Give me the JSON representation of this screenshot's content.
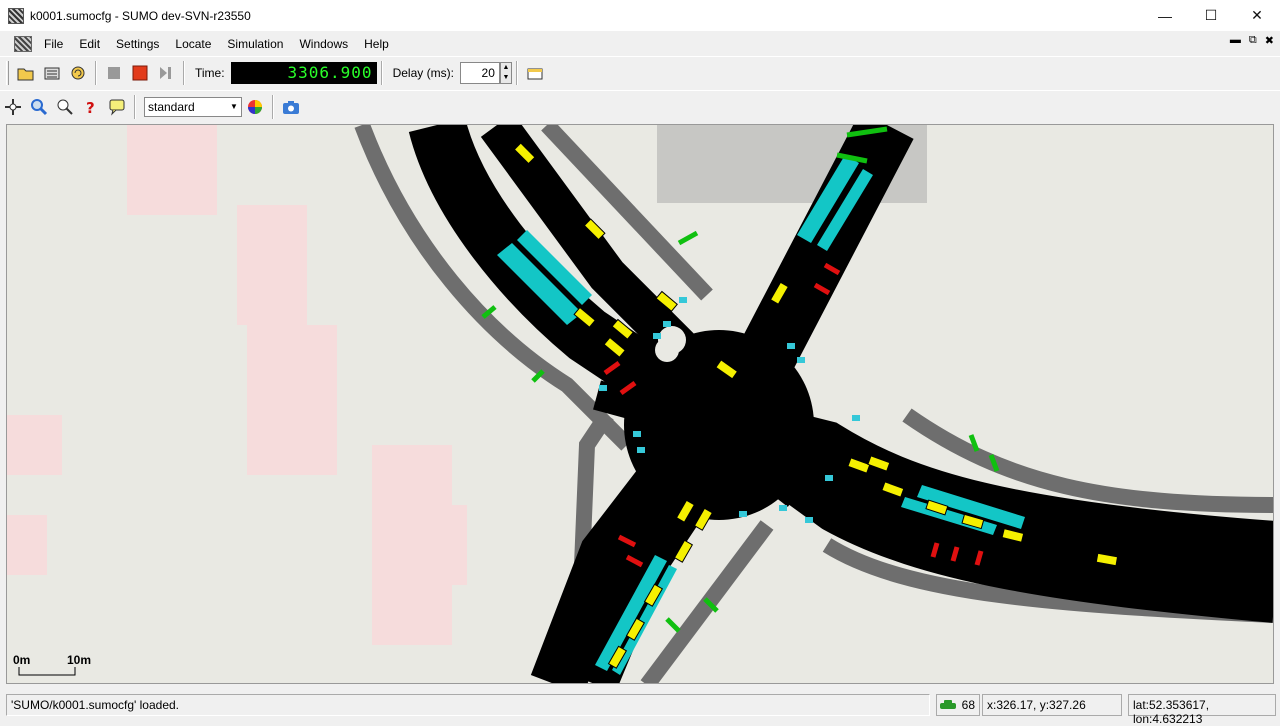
{
  "window": {
    "title": "k0001.sumocfg - SUMO dev-SVN-r23550"
  },
  "menu": [
    "File",
    "Edit",
    "Settings",
    "Locate",
    "Simulation",
    "Windows",
    "Help"
  ],
  "toolbar": {
    "time_label": "Time:",
    "time_value": "3306.900",
    "delay_label": "Delay (ms):",
    "delay_value": "20"
  },
  "viewbar": {
    "scheme": "standard"
  },
  "scale": {
    "left": "0m",
    "right": "10m"
  },
  "status": {
    "message": "'SUMO/k0001.sumocfg' loaded.",
    "vehicles": "68",
    "coords": "x:326.17, y:327.26",
    "geo": "lat:52.353617, lon:4.632213"
  },
  "colors": {
    "road": "#000000",
    "sidewalk": "#6e6e6e",
    "busstop": "#13c6c6",
    "tl_red": "#e01010",
    "tl_green": "#10c010",
    "vehicle": "#f5f000",
    "background": "#e9e9e3",
    "building": "#f6d8d8"
  }
}
